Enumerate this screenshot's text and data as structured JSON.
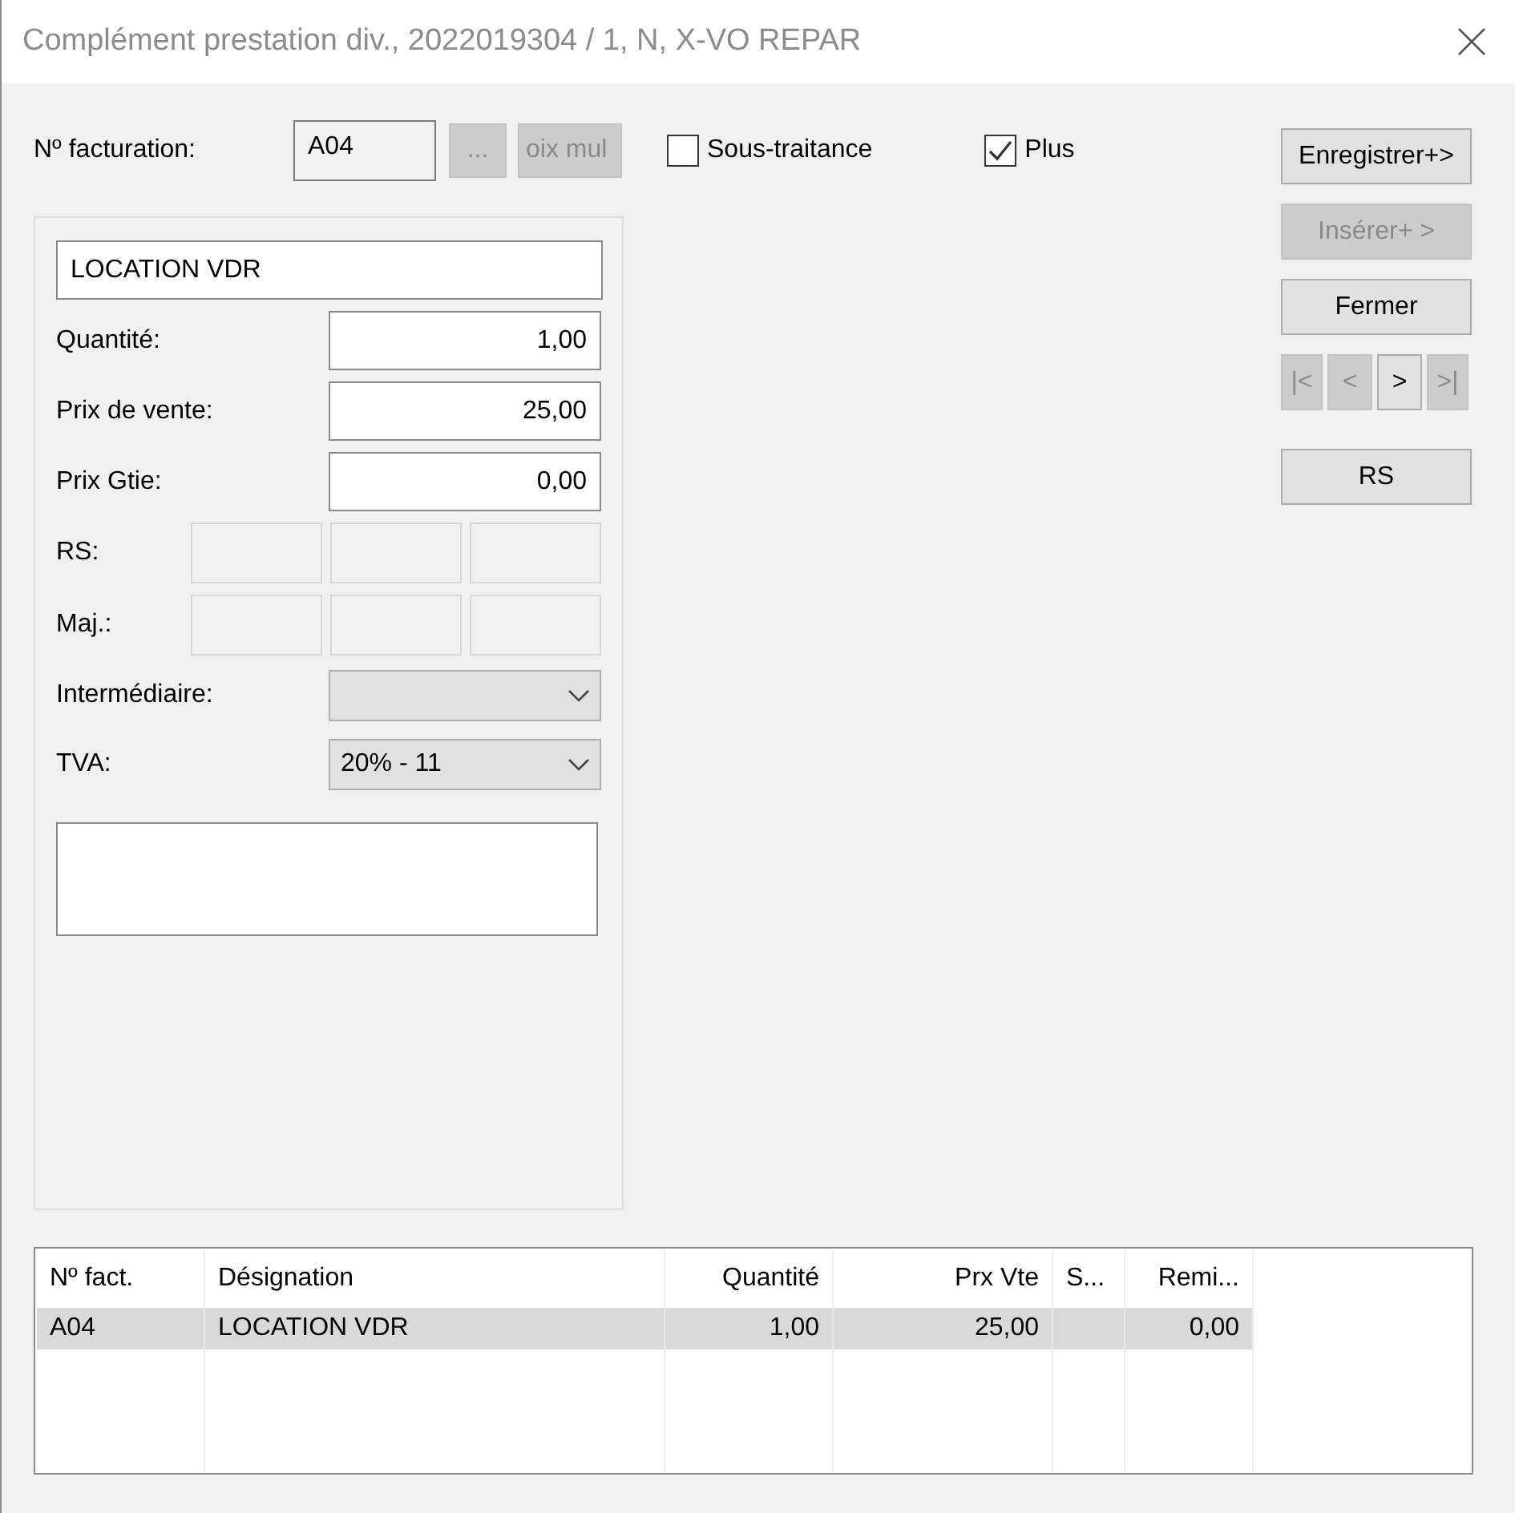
{
  "window": {
    "title": "Complément prestation div., 2022019304 / 1, N, X-VO REPAR"
  },
  "billing": {
    "label": "Nº facturation:",
    "value": "A04"
  },
  "billing_buttons": [
    {
      "label": "...",
      "disabled": true
    },
    {
      "label": "oix mul",
      "disabled": true
    }
  ],
  "checkboxes": [
    {
      "label": "Sous-traitance",
      "checked": false
    },
    {
      "label": "Plus",
      "checked": true
    }
  ],
  "side_buttons": [
    {
      "label": "Enregistrer+>",
      "disabled": false
    },
    {
      "label": "Insérer+ >",
      "disabled": true
    },
    {
      "label": "Fermer",
      "disabled": false
    }
  ],
  "nav_buttons": [
    {
      "label": "|<",
      "disabled": true
    },
    {
      "label": "<",
      "disabled": true
    },
    {
      "label": ">",
      "disabled": false
    },
    {
      "label": ">|",
      "disabled": true
    }
  ],
  "rs_button": {
    "label": "RS",
    "disabled": false
  },
  "panel": {
    "designation": "LOCATION VDR",
    "rows": [
      {
        "kind": "input",
        "label": "Quantité:",
        "value": "1,00"
      },
      {
        "kind": "input",
        "label": "Prix de vente:",
        "value": "25,00"
      },
      {
        "kind": "input",
        "label": "Prix Gtie:",
        "value": "0,00"
      },
      {
        "kind": "cells",
        "label": "RS:"
      },
      {
        "kind": "cells",
        "label": "Maj.:"
      },
      {
        "kind": "select",
        "label": "Intermédiaire:"
      },
      {
        "kind": "select",
        "label": "TVA:",
        "value": "20% - 11"
      }
    ]
  },
  "table": {
    "columns": [
      {
        "label": "Nº fact.",
        "numeric": false
      },
      {
        "label": "Désignation",
        "numeric": false
      },
      {
        "label": "Quantité",
        "numeric": true
      },
      {
        "label": "Prx Vte",
        "numeric": true
      },
      {
        "label": "S...",
        "numeric": false
      },
      {
        "label": "Remi...",
        "numeric": true
      }
    ],
    "rows": [
      {
        "selected": true,
        "cells": [
          "A04",
          "LOCATION VDR",
          "1,00",
          "25,00",
          null,
          "0,00"
        ]
      }
    ]
  }
}
